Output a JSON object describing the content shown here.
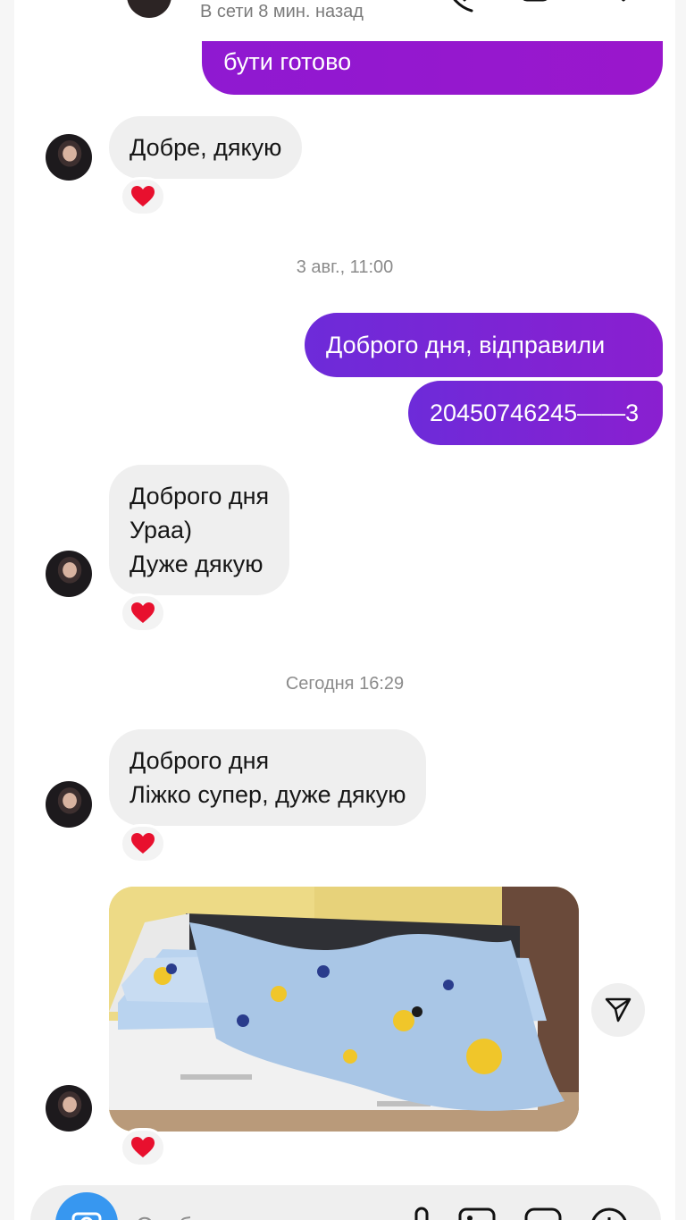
{
  "header": {
    "status": "В сети 8 мин. назад"
  },
  "messages": {
    "out_top": "бути готово",
    "in_1": "Добре, дякую",
    "ts_1": "3 авг., 11:00",
    "out_1": "Доброго дня, відправили",
    "out_2": "20450746245——3",
    "in_2_lines": [
      "Доброго дня",
      "Ураа)",
      "Дуже дякую"
    ],
    "ts_2": "Сегодня 16:29",
    "in_3_lines": [
      "Доброго дня",
      "Ліжко супер, дуже дякую"
    ]
  },
  "reaction": "heart",
  "composer": {
    "placeholder": "Сообщение..."
  },
  "colors": {
    "outgoing_bubble": "#6d2bd9",
    "outgoing_bubble_top": "#9a17cc",
    "incoming_bubble": "#efefef",
    "reaction_heart": "#e8102e",
    "camera_button": "#3797f0"
  }
}
